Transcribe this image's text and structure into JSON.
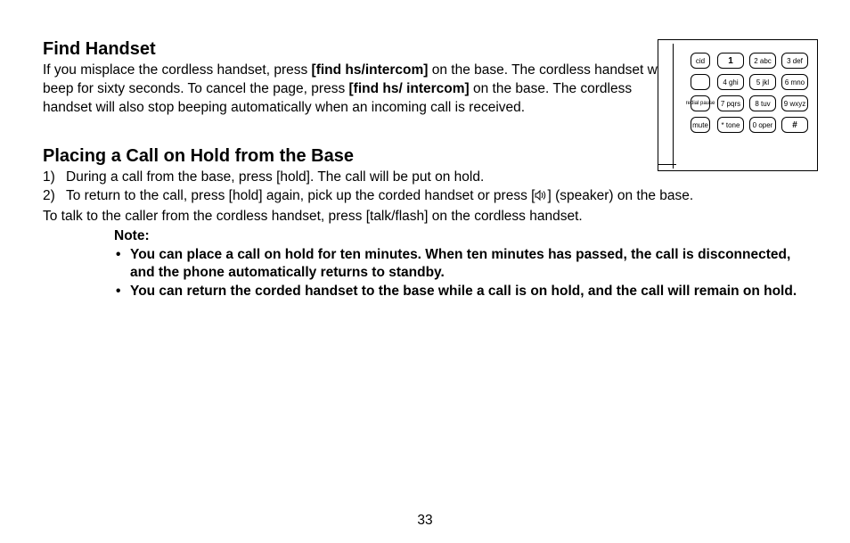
{
  "section1": {
    "heading": "Find Handset",
    "text_parts": {
      "p1": "If you misplace the cordless handset, press ",
      "b1": "[find hs/intercom]",
      "p2": " on the base. The cordless handset will beep for sixty seconds. To cancel the page, press ",
      "b2": "[find hs/ intercom]",
      "p3": " on the base. The cordless handset will also stop beeping automatically when an incoming call is received."
    }
  },
  "section2": {
    "heading": "Placing a Call on Hold from the Base",
    "item1": {
      "num": "1)",
      "p1": "During a call from the base, press ",
      "b1": "[hold]",
      "p2": ". The call will be put on hold."
    },
    "item2": {
      "num": "2)",
      "p1": "To return to the call, press ",
      "b1": "[hold]",
      "p2": " again, pick up the corded handset or press ",
      "b2a": "[",
      "b2b": "]",
      "p3": " (speaker) on the base."
    },
    "tail": {
      "p1": "To talk to the caller from the cordless handset, press ",
      "b1": "[talk/flash]",
      "p2": " on the cordless handset."
    }
  },
  "note": {
    "label": "Note:",
    "items": [
      "You can place a call on hold for ten minutes. When ten minutes has passed, the call is disconnected, and the phone automatically returns to standby.",
      "You can return the corded handset to the base while a call is on hold, and the call will remain on hold."
    ]
  },
  "keypad": {
    "sideKeys": [
      "cid",
      "",
      "redial pause",
      "mute"
    ],
    "keys": [
      [
        "1",
        "2 abc",
        "3 def"
      ],
      [
        "4 ghi",
        "5 jkl",
        "6 mno"
      ],
      [
        "7 pqrs",
        "8 tuv",
        "9 wxyz"
      ],
      [
        "* tone",
        "0 oper",
        "#"
      ]
    ]
  },
  "pageNumber": "33"
}
